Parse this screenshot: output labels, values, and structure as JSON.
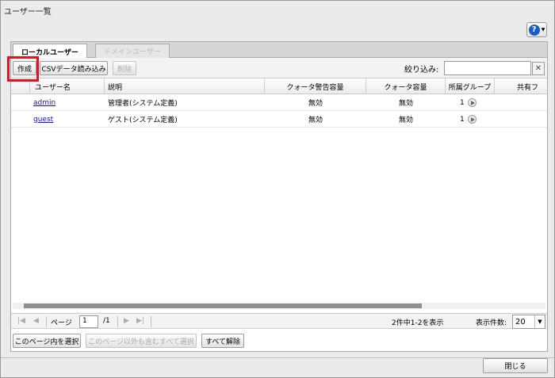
{
  "window": {
    "title": "ユーザー一覧"
  },
  "help": {
    "icon": "help-icon",
    "glyph": "?",
    "caret": "▼"
  },
  "tabs": [
    {
      "label": "ローカルユーザー",
      "active": true
    },
    {
      "label": "ドメインユーザー",
      "enabled": false
    }
  ],
  "toolbar": {
    "create_label": "作成",
    "csv_label": "CSVデータ読み込み",
    "delete_label": "削除",
    "filter_label": "絞り込み:",
    "filter_value": "",
    "clear_glyph": "✕"
  },
  "table": {
    "columns": [
      "ユーザー名",
      "説明",
      "クォータ警告容量",
      "クォータ容量",
      "所属グループ",
      "共有フ"
    ],
    "rows": [
      {
        "username": "admin",
        "description": "管理者(システム定義)",
        "quota_warning": "無効",
        "quota": "無効",
        "groups": "1"
      },
      {
        "username": "guest",
        "description": "ゲスト(システム定義)",
        "quota_warning": "無効",
        "quota": "無効",
        "groups": "1"
      }
    ]
  },
  "pager": {
    "page_label": "ページ",
    "page_value": "1",
    "total_pages": "/1",
    "summary": "2件中1-2を表示",
    "per_page_label": "表示件数:",
    "per_page_value": "20",
    "first": "|◀",
    "prev": "◀",
    "next": "▶",
    "last": "▶|"
  },
  "selection": {
    "select_page": "このページ内を選択",
    "select_all": "このページ以外も含むすべて選択",
    "clear_all": "すべて解除"
  },
  "footer": {
    "close_label": "閉じる"
  }
}
